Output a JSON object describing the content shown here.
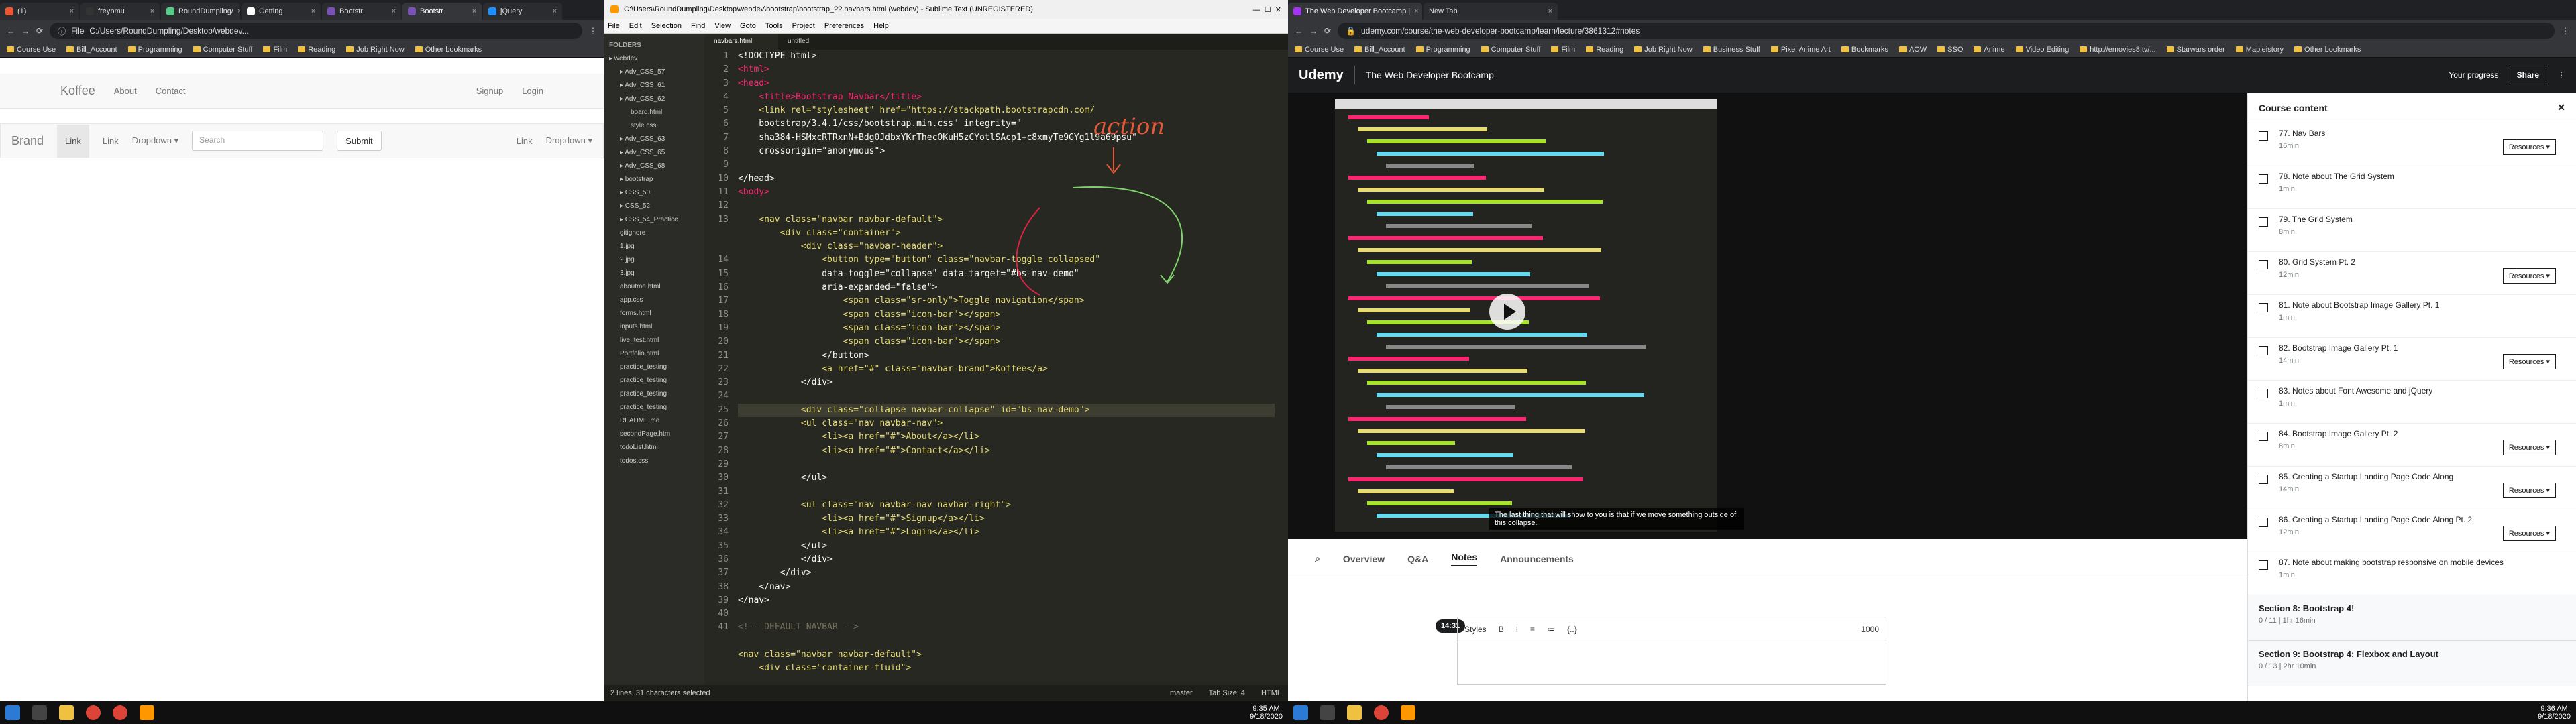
{
  "left": {
    "tabs": [
      "(1)",
      "freybmu",
      "RoundDumpling/",
      "Getting",
      "Bootstr",
      "Bootstr",
      "jQuery"
    ],
    "url": "C:/Users/RoundDumpling/Desktop/webdev...",
    "file_label": "File",
    "bookmarks": [
      "Course Use",
      "Bill_Account",
      "Programming",
      "Computer Stuff",
      "Film",
      "Reading",
      "Job Right Now",
      "Other bookmarks"
    ],
    "preview": {
      "nav1": {
        "brand": "Koffee",
        "links": [
          "About",
          "Contact"
        ],
        "right": [
          "Signup",
          "Login"
        ]
      },
      "nav2": {
        "brand": "Brand",
        "links": [
          "Link",
          "Link",
          "Dropdown ▾"
        ],
        "search_placeholder": "Search",
        "submit": "Submit",
        "right": [
          "Link",
          "Dropdown ▾"
        ]
      }
    },
    "sublime": {
      "title": "C:\\Users\\RoundDumpling\\Desktop\\webdev\\bootstrap\\bootstrap_??.navbars.html (webdev) - Sublime Text (UNREGISTERED)",
      "menu": [
        "File",
        "Edit",
        "Selection",
        "Find",
        "View",
        "Goto",
        "Tools",
        "Project",
        "Preferences",
        "Help"
      ],
      "folders_label": "FOLDERS",
      "folders": [
        "webdev",
        "Adv_CSS_57",
        "Adv_CSS_61",
        "Adv_CSS_62",
        "board.html",
        "style.css",
        "Adv_CSS_63",
        "Adv_CSS_65",
        "Adv_CSS_68",
        "bootstrap",
        "CSS_50",
        "CSS_52",
        "CSS_54_Practice",
        "gitignore",
        "1.jpg",
        "2.jpg",
        "3.jpg",
        "aboutme.html",
        "app.css",
        "forms.html",
        "inputs.html",
        "live_test.html",
        "Portfolio.html",
        "practice_testing",
        "practice_testing",
        "practice_testing",
        "practice_testing",
        "README.md",
        "secondPage.htm",
        "todoList.html",
        "todos.css"
      ],
      "tabs": [
        "navbars.html",
        "untitled"
      ],
      "line_numbers": [
        "1",
        "2",
        "3",
        "4",
        "5",
        "6",
        "7",
        "8",
        "9",
        "10",
        "11",
        "12",
        "13",
        "",
        "",
        "14",
        "15",
        "16",
        "17",
        "18",
        "19",
        "20",
        "21",
        "22",
        "23",
        "24",
        "25",
        "26",
        "27",
        "28",
        "29",
        "30",
        "31",
        "32",
        "33",
        "34",
        "35",
        "36",
        "37",
        "38",
        "39",
        "40",
        "41"
      ],
      "code": [
        "<!DOCTYPE html>",
        "<html>",
        "<head>",
        "    <title>Bootstrap Navbar</title>",
        "    <link rel=\"stylesheet\" href=\"https://stackpath.bootstrapcdn.com/",
        "    bootstrap/3.4.1/css/bootstrap.min.css\" integrity=\"",
        "    sha384-HSMxcRTRxnN+Bdg0JdbxYKrThecOKuH5zCYotlSAcp1+c8xmyTe9GYg1l9a69psu\"",
        "    crossorigin=\"anonymous\">",
        "",
        "</head>",
        "<body>",
        "",
        "    <nav class=\"navbar navbar-default\">",
        "        <div class=\"container\">",
        "            <div class=\"navbar-header\">",
        "                <button type=\"button\" class=\"navbar-toggle collapsed\"",
        "                data-toggle=\"collapse\" data-target=\"#bs-nav-demo\"",
        "                aria-expanded=\"false\">",
        "                    <span class=\"sr-only\">Toggle navigation</span>",
        "                    <span class=\"icon-bar\"></span>",
        "                    <span class=\"icon-bar\"></span>",
        "                    <span class=\"icon-bar\"></span>",
        "                </button>",
        "                <a href=\"#\" class=\"navbar-brand\">Koffee</a>",
        "            </div>",
        "",
        "            <div class=\"collapse navbar-collapse\" id=\"bs-nav-demo\">",
        "            <ul class=\"nav navbar-nav\">",
        "                <li><a href=\"#\">About</a></li>",
        "                <li><a href=\"#\">Contact</a></li>",
        "",
        "            </ul>",
        "",
        "            <ul class=\"nav navbar-nav navbar-right\">",
        "                <li><a href=\"#\">Signup</a></li>",
        "                <li><a href=\"#\">Login</a></li>",
        "            </ul>",
        "            </div>",
        "        </div>",
        "    </nav>",
        "</nav>",
        "",
        "<!-- DEFAULT NAVBAR -->",
        "",
        "<nav class=\"navbar navbar-default\">",
        "    <div class=\"container-fluid\">"
      ],
      "annotation": "action",
      "status": "2 lines, 31 characters selected",
      "status_right": [
        "master",
        "Tab Size: 4",
        "HTML"
      ]
    },
    "clock": {
      "time": "9:35 AM",
      "date": "9/18/2020"
    }
  },
  "right": {
    "tabs": [
      "The Web Developer Bootcamp |",
      "New Tab"
    ],
    "url": "udemy.com/course/the-web-developer-bootcamp/learn/lecture/3861312#notes",
    "bookmarks": [
      "Course Use",
      "Bill_Account",
      "Programming",
      "Computer Stuff",
      "Film",
      "Reading",
      "Job Right Now",
      "Business Stuff",
      "Pixel Anime Art",
      "Bookmarks",
      "AOW",
      "SSO",
      "Anime",
      "Video Editing",
      "http://emovies8.tv/...",
      "Starwars order",
      "Mapleistory",
      "Other bookmarks"
    ],
    "udemy": {
      "logo": "Udemy",
      "course": "The Web Developer Bootcamp",
      "progress": "Your progress",
      "share": "Share",
      "subtitle": "The last thing that will show to you is that if we move something outside of this collapse.",
      "tabs": [
        "Overview",
        "Q&A",
        "Notes",
        "Announcements"
      ],
      "timestamp": "14:31",
      "toolbar": [
        "Styles",
        "B",
        "I",
        "≡",
        "≔",
        "{..}"
      ],
      "char_count": "1000",
      "panel_title": "Course content",
      "lectures": [
        {
          "title": "77. Nav Bars",
          "dur": "16min",
          "res": true
        },
        {
          "title": "78. Note about The Grid System",
          "dur": "1min",
          "res": false
        },
        {
          "title": "79. The Grid System",
          "dur": "8min",
          "res": false
        },
        {
          "title": "80. Grid System Pt. 2",
          "dur": "12min",
          "res": true
        },
        {
          "title": "81. Note about Bootstrap Image Gallery Pt. 1",
          "dur": "1min",
          "res": false
        },
        {
          "title": "82. Bootstrap Image Gallery Pt. 1",
          "dur": "14min",
          "res": true
        },
        {
          "title": "83. Notes about Font Awesome and jQuery",
          "dur": "1min",
          "res": false
        },
        {
          "title": "84. Bootstrap Image Gallery Pt. 2",
          "dur": "8min",
          "res": true
        },
        {
          "title": "85. Creating a Startup Landing Page Code Along",
          "dur": "14min",
          "res": true
        },
        {
          "title": "86. Creating a Startup Landing Page Code Along Pt. 2",
          "dur": "12min",
          "res": true
        },
        {
          "title": "87. Note about making bootstrap responsive on mobile devices",
          "dur": "1min",
          "res": false
        }
      ],
      "resources_label": "Resources",
      "sections": [
        {
          "title": "Section 8: Bootstrap 4!",
          "meta": "0 / 11 | 1hr 16min"
        },
        {
          "title": "Section 9: Bootstrap 4: Flexbox and Layout",
          "meta": "0 / 13 | 2hr 10min"
        }
      ]
    },
    "clock": {
      "time": "9:36 AM",
      "date": "9/18/2020"
    }
  },
  "colors": {
    "udemy_purple": "#a435f0",
    "sublime_bg": "#272822",
    "annotation": "#e35a3a",
    "annotation_green": "#7ed36a"
  }
}
